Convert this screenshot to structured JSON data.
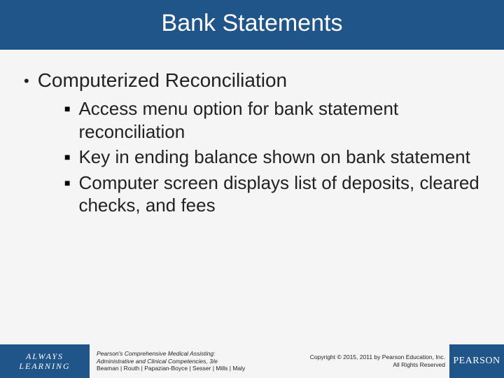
{
  "title": "Bank Statements",
  "heading": "Computerized Reconciliation",
  "bullets": [
    "Access menu option for bank statement reconciliation",
    "Key in ending balance shown on bank statement",
    "Computer screen displays list of deposits, cleared checks, and fees"
  ],
  "footer": {
    "always_learning_1": "ALWAYS",
    "always_learning_2": "LEARNING",
    "book_line1": "Pearson's Comprehensive Medical Assisting:",
    "book_line2": "Administrative and Clinical Competencies, 3/e",
    "book_line3": "Beaman | Routh | Papazian-Boyce | Sesser | Mills | Maly",
    "copyright_line1": "Copyright © 2015, 2011 by Pearson Education, Inc.",
    "copyright_line2": "All Rights Reserved",
    "pearson": "PEARSON"
  }
}
